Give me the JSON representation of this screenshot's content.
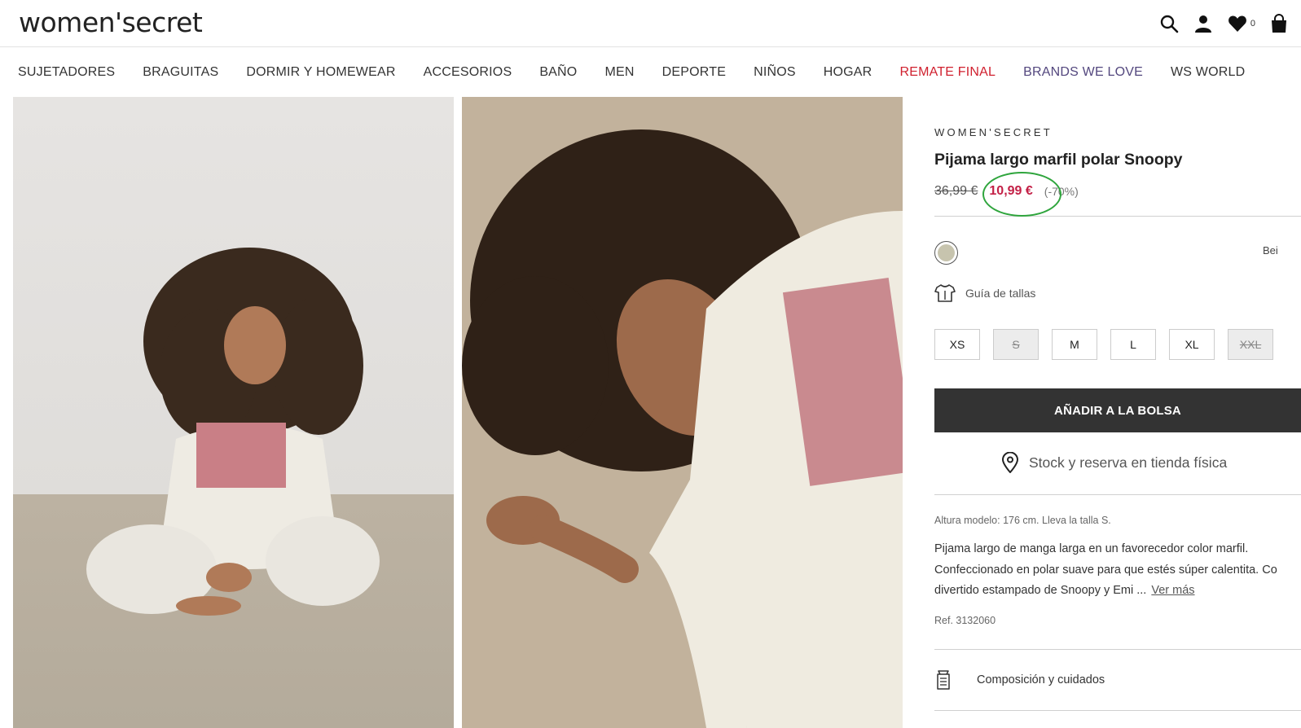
{
  "header": {
    "logo": "women'secret",
    "favorites_count": "0",
    "icons": [
      "search-icon",
      "user-icon",
      "heart-icon",
      "bag-icon"
    ]
  },
  "nav": {
    "items": [
      {
        "label": "SUJETADORES"
      },
      {
        "label": "BRAGUITAS"
      },
      {
        "label": "DORMIR Y HOMEWEAR"
      },
      {
        "label": "ACCESORIOS"
      },
      {
        "label": "BAÑO"
      },
      {
        "label": "MEN"
      },
      {
        "label": "DEPORTE"
      },
      {
        "label": "NIÑOS"
      },
      {
        "label": "HOGAR"
      },
      {
        "label": "REMATE FINAL"
      },
      {
        "label": "BRANDS WE LOVE"
      },
      {
        "label": "WS WORLD"
      }
    ],
    "colors": {
      "default": "#333333",
      "sale": "#d0212f",
      "brands": "#53477e"
    }
  },
  "product": {
    "brand": "WOMEN'SECRET",
    "title": "Pijama largo marfil polar Snoopy",
    "old_price": "36,99 €",
    "price": "10,99 €",
    "discount": "(-70%)",
    "price_color": "#c32046",
    "color": {
      "name": "Bei",
      "swatch": "#c7c4ae"
    },
    "size_guide": "Guía de tallas",
    "sizes": [
      {
        "label": "XS",
        "available": true
      },
      {
        "label": "S",
        "available": false
      },
      {
        "label": "M",
        "available": true
      },
      {
        "label": "L",
        "available": true
      },
      {
        "label": "XL",
        "available": true
      },
      {
        "label": "XXL",
        "available": false
      }
    ],
    "add_to_bag": "AÑADIR A LA BOLSA",
    "stock": "Stock y reserva en tienda física",
    "model_info": "Altura modelo: 176 cm.  Lleva la talla S.",
    "description_lines": [
      "Pijama largo de manga larga en un favorecedor color marfil.",
      "Confeccionado en polar suave para que estés súper calentita. Co",
      "divertido estampado de Snoopy y Emi ..."
    ],
    "see_more": "Ver más",
    "ref": "Ref. 3132060",
    "composition": "Composición y cuidados"
  }
}
